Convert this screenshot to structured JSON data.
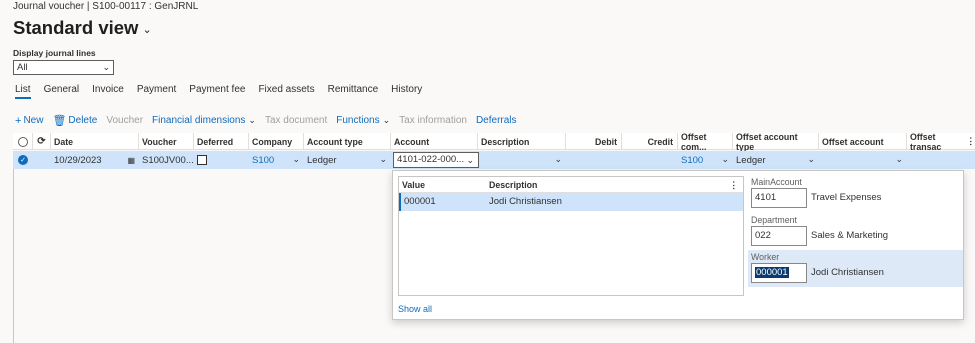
{
  "header": {
    "breadcrumb": "Journal voucher  |  S100-00117 : GenJRNL",
    "title": "Standard view"
  },
  "display_lines": {
    "label": "Display journal lines",
    "value": "All"
  },
  "tabs": [
    {
      "label": "List",
      "active": true
    },
    {
      "label": "General"
    },
    {
      "label": "Invoice"
    },
    {
      "label": "Payment"
    },
    {
      "label": "Payment fee"
    },
    {
      "label": "Fixed assets"
    },
    {
      "label": "Remittance"
    },
    {
      "label": "History"
    }
  ],
  "toolbar": {
    "new": "New",
    "delete": "Delete",
    "voucher": "Voucher",
    "financial_dimensions": "Financial dimensions",
    "tax_document": "Tax document",
    "functions": "Functions",
    "tax_information": "Tax information",
    "deferrals": "Deferrals"
  },
  "grid": {
    "columns": {
      "date": "Date",
      "voucher": "Voucher",
      "deferred": "Deferred",
      "company": "Company",
      "account_type": "Account type",
      "account": "Account",
      "description": "Description",
      "debit": "Debit",
      "credit": "Credit",
      "offset_company": "Offset com...",
      "offset_account_type": "Offset account type",
      "offset_account": "Offset account",
      "offset_transaction": "Offset transac"
    },
    "row": {
      "date": "10/29/2023",
      "voucher": "S100JV00...",
      "company": "S100",
      "account_type": "Ledger",
      "account": "4101-022-000...",
      "offset_company": "S100",
      "offset_account_type": "Ledger"
    }
  },
  "lookup": {
    "col_value": "Value",
    "col_description": "Description",
    "rows": [
      {
        "value": "000001",
        "description": "Jodi Christiansen"
      }
    ],
    "show_all": "Show all"
  },
  "segments": [
    {
      "label": "MainAccount",
      "value": "4101",
      "description": "Travel Expenses"
    },
    {
      "label": "Department",
      "value": "022",
      "description": "Sales & Marketing"
    },
    {
      "label": "Worker",
      "value": "000001",
      "description": "Jodi Christiansen"
    }
  ]
}
